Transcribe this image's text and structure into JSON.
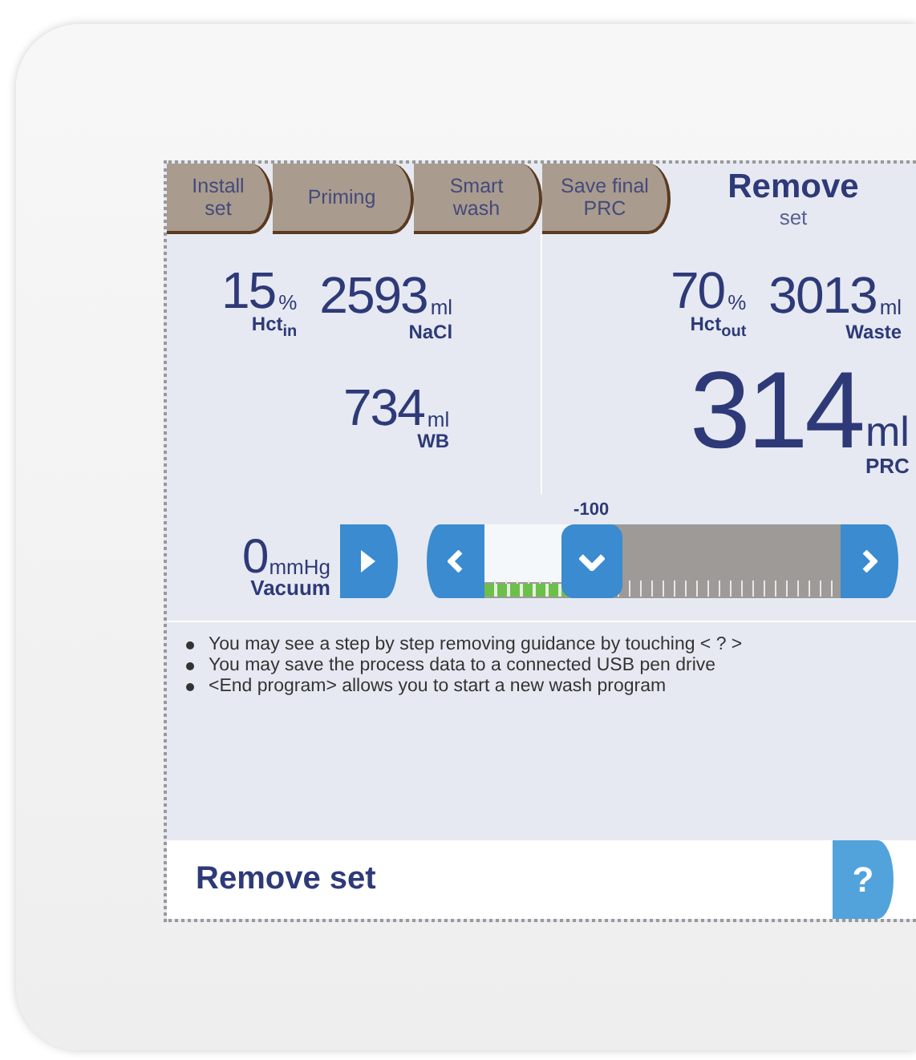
{
  "tabs": [
    {
      "label": "Install set",
      "selected": false
    },
    {
      "label": "Priming",
      "selected": false
    },
    {
      "label": "Smart wash",
      "selected": false
    },
    {
      "label": "Save final PRC",
      "selected": false
    },
    {
      "label": "Remove",
      "sublabel": "set",
      "selected": true
    }
  ],
  "panels": [
    {
      "readings": [
        {
          "value": "15",
          "unit": "%",
          "label": "Hct$_{in}$",
          "kind": "small"
        },
        {
          "value": "2593",
          "unit": "ml",
          "label": "NaCl",
          "kind": "small"
        },
        {
          "value": "734",
          "unit": "ml",
          "label": "WB",
          "kind": "small"
        }
      ]
    },
    {
      "readings": [
        {
          "value": "70",
          "unit": "%",
          "label": "Hct$_{out}$",
          "kind": "small"
        },
        {
          "value": "3013",
          "unit": "ml",
          "label": "Waste",
          "kind": "small"
        },
        {
          "value": "314",
          "unit": "ml",
          "label": "PRC",
          "kind": "large"
        }
      ]
    }
  ],
  "vacuum": {
    "value": "0",
    "unit": "mmHg",
    "label": "Vacuum"
  },
  "slider": {
    "setpoint": "-100",
    "level": 0.3
  },
  "meter": {
    "level": 0.34
  },
  "notes": [
    "You may see a step by step removing guidance by touching < ? >",
    "You may save the process data to a connected USB pen drive",
    "<End program> allows you to start a new wash program"
  ],
  "footer": {
    "title": "Remove set",
    "help": "?"
  }
}
